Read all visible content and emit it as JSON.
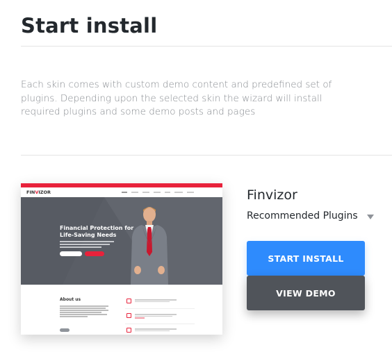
{
  "header": {
    "title": "Start install"
  },
  "intro": {
    "text": "Each skin comes with custom demo content and predefined set of plugins. Depending upon the selected skin the wizard will install required plugins and some demo posts and pages"
  },
  "skin": {
    "name": "Finvizor",
    "plugins_label": "Recommended Plugins",
    "install_label": "START INSTALL",
    "demo_label": "VIEW DEMO"
  },
  "preview": {
    "logo_prefix": "FIN",
    "logo_x": "V",
    "logo_suffix": "IZOR",
    "hero_title": "Financial Protection for Life-Saving Needs",
    "about_title": "About us"
  },
  "colors": {
    "accent_red": "#e8223b",
    "install_blue": "#2e8bfd",
    "demo_gray": "#50545a"
  }
}
